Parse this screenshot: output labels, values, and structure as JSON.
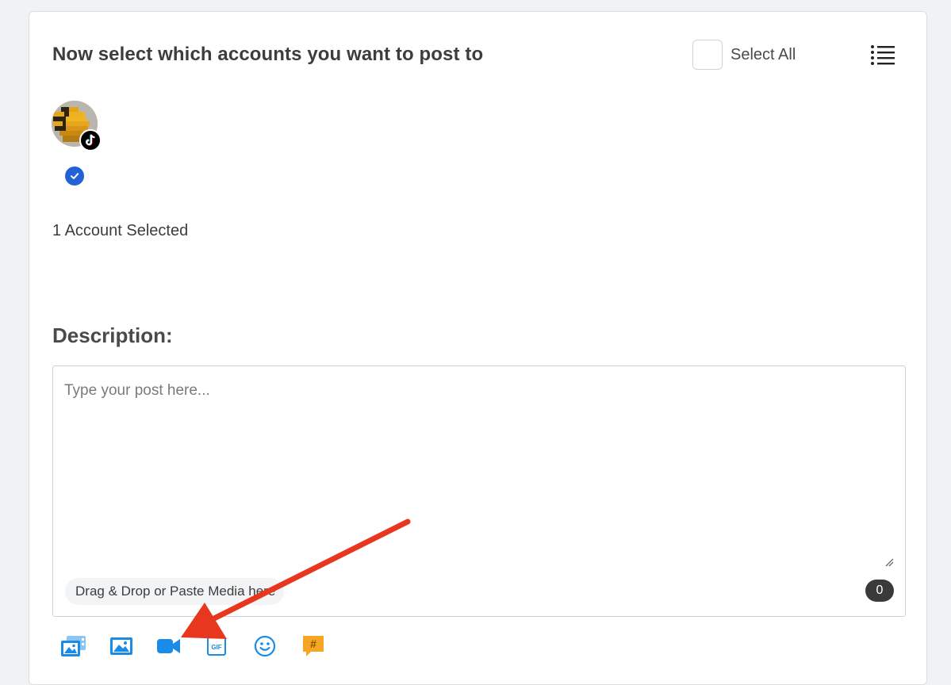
{
  "header": {
    "title": "Now select which accounts you want to post to",
    "select_all_label": "Select All",
    "list_view_icon": "list-icon"
  },
  "accounts": [
    {
      "platform_icon": "tiktok-icon",
      "selected": true,
      "selected_icon": "checkmark-icon"
    }
  ],
  "selection_summary": "1 Account Selected",
  "description": {
    "label": "Description:",
    "placeholder": "Type your post here...",
    "value": "",
    "drop_hint": "Drag & Drop or Paste Media here",
    "char_count": "0"
  },
  "toolbar": {
    "icons": [
      "media-library-icon",
      "image-icon",
      "video-camera-icon",
      "gif-icon",
      "emoji-icon",
      "hashtag-icon"
    ]
  },
  "colors": {
    "accent_blue": "#1a8ce8",
    "check_blue": "#2262d6",
    "hashtag_orange": "#f5a623",
    "annotation_red": "#e8371f"
  }
}
